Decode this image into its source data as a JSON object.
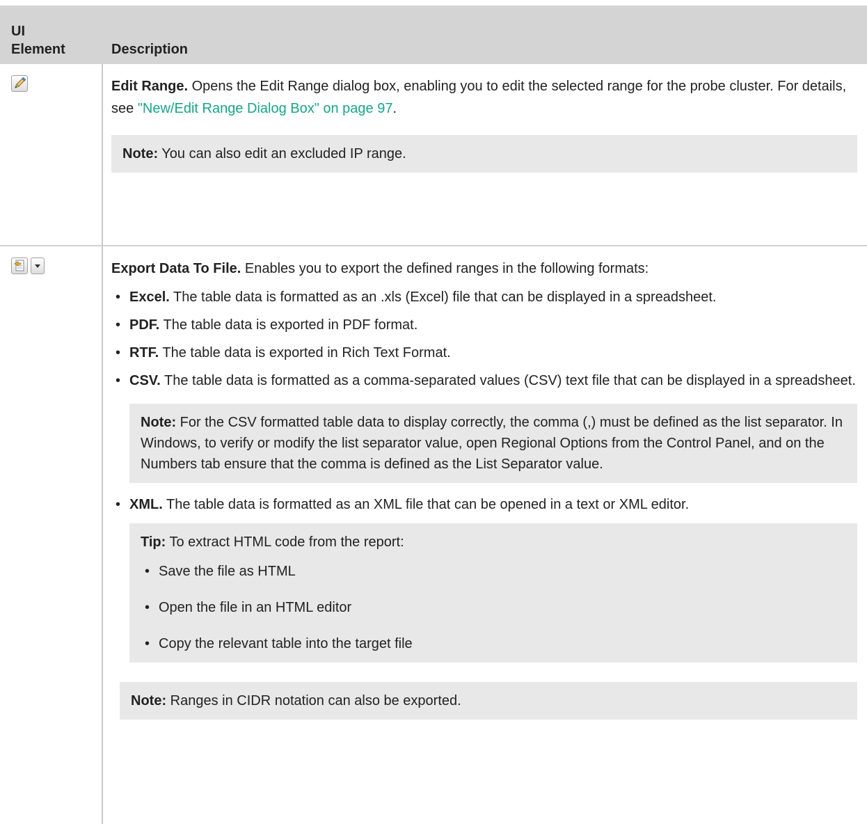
{
  "table": {
    "header_ui": "UI Element",
    "header_desc": "Description"
  },
  "rows": {
    "edit_range": {
      "icon": "pencil-icon",
      "title": "Edit Range.",
      "text_before_link": " Opens the Edit Range dialog box, enabling you to edit the selected range for the probe cluster. For details, see ",
      "link": "\"New/Edit Range Dialog Box\" on page 97",
      "text_after_link": ".",
      "note_label": "Note:",
      "note_text": " You can also edit an excluded IP range."
    },
    "export": {
      "icon": "export-file-icon",
      "title": "Export Data To File.",
      "intro": " Enables you to export the defined ranges in the following formats:",
      "formats": [
        {
          "name": "Excel.",
          "text": " The table data is formatted as an .xls (Excel) file that can be displayed in a spreadsheet."
        },
        {
          "name": "PDF.",
          "text": " The table data is exported in PDF format."
        },
        {
          "name": "RTF.",
          "text": " The table data is exported in Rich Text Format."
        },
        {
          "name": "CSV.",
          "text": " The table data is formatted as a comma-separated values (CSV) text file that can be displayed in a spreadsheet."
        }
      ],
      "csv_note_label": "Note:",
      "csv_note_text": " For the CSV formatted table data to display correctly, the comma (,) must be defined as the list separator. In Windows, to verify or modify the list separator value, open Regional Options from the Control Panel, and on the Numbers tab ensure that the comma is defined as the List Separator value.",
      "xml": {
        "name": "XML.",
        "text": " The table data is formatted as an XML file that can be opened in a text or XML editor."
      },
      "tip_label": "Tip:",
      "tip_text": " To extract HTML code from the report:",
      "tip_steps": [
        "Save the file as HTML",
        "Open the file in an HTML editor",
        "Copy the relevant table into the target file"
      ],
      "final_note_label": "Note:",
      "final_note_text": " Ranges in CIDR notation can also be exported."
    }
  }
}
